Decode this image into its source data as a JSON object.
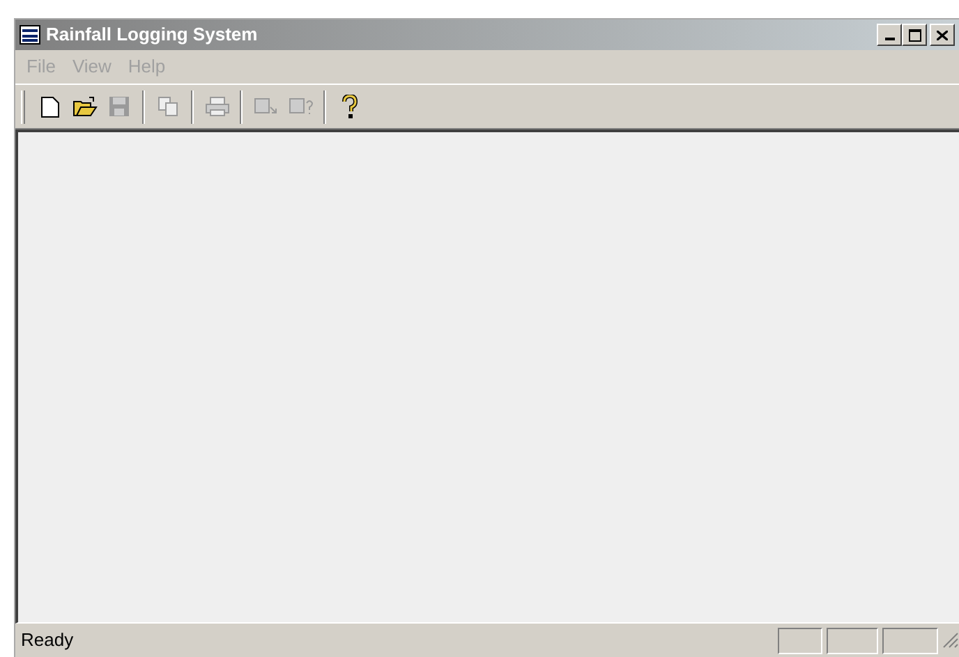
{
  "window": {
    "title": "Rainfall Logging System",
    "active": false
  },
  "menu": [
    {
      "label": "File",
      "disabled": true
    },
    {
      "label": "View",
      "disabled": true
    },
    {
      "label": "Help",
      "disabled": true
    }
  ],
  "toolbar": [
    {
      "kind": "new",
      "disabled": false
    },
    {
      "kind": "open",
      "disabled": false
    },
    {
      "kind": "save",
      "disabled": true
    },
    {
      "kind": "separator"
    },
    {
      "kind": "copy",
      "disabled": true
    },
    {
      "kind": "separator"
    },
    {
      "kind": "print",
      "disabled": true
    },
    {
      "kind": "separator"
    },
    {
      "kind": "context",
      "disabled": true
    },
    {
      "kind": "whats-this",
      "disabled": true
    },
    {
      "kind": "separator"
    },
    {
      "kind": "help",
      "disabled": false
    }
  ],
  "status_bar": {
    "text": "Ready"
  }
}
